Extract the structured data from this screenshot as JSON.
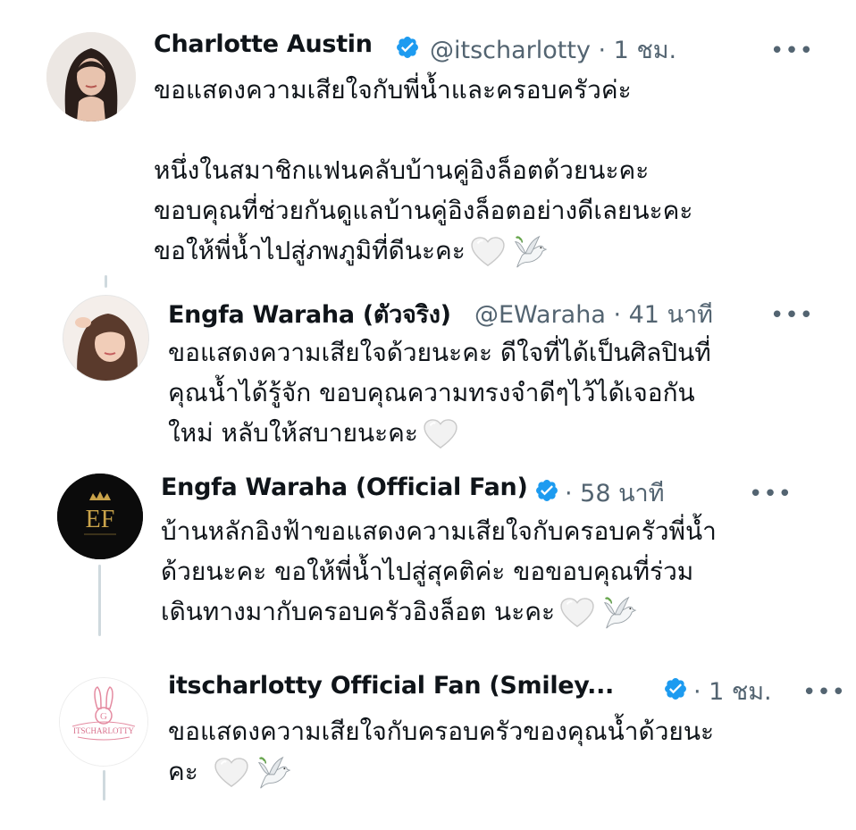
{
  "tweets": [
    {
      "name": "Charlotte Austin",
      "verified": true,
      "handle_time": "@itscharlotty · 1 ชม.",
      "text": "ขอแสดงความเสียใจกับพี่น้ำและครอบครัวค่ะ\n\nหนึ่งในสมาชิกแฟนคลับบ้านคู่อิงล็อตด้วยนะคะ\nขอบคุณที่ช่วยกันดูแลบ้านคู่อิงล็อตอย่างดีเลยนะคะ\nขอให้พี่น้ำไปสู่ภพภูมิที่ดีนะคะ",
      "emojis": [
        "white-heart-icon",
        "dove-icon"
      ],
      "more": "•••"
    },
    {
      "name": "Engfa Waraha (ตัวจริง)",
      "verified": false,
      "handle_time": "@EWaraha · 41 นาที",
      "text": "ขอแสดงความเสียใจด้วยนะคะ ดีใจที่ได้เป็นศิลปินที่\nคุณน้ำได้รู้จัก ขอบคุณความทรงจำดีๆไว้ได้เจอกัน\nใหม่ หลับให้สบายนะคะ",
      "emojis": [
        "white-heart-icon"
      ],
      "more": "•••"
    },
    {
      "name": "Engfa Waraha (Official Fan)",
      "verified": true,
      "handle_time": "· 58 นาที",
      "text": "บ้านหลักอิงฟ้าขอแสดงความเสียใจกับครอบครัวพี่น้ำ\nด้วยนะคะ ขอให้พี่น้ำไปสู่สุคติค่ะ ขอขอบคุณที่ร่วม\nเดินทางมากับครอบครัวอิงล็อต นะคะ",
      "emojis": [
        "white-heart-icon",
        "dove-icon"
      ],
      "more": "•••",
      "avatar_logo": "EF"
    },
    {
      "name": "itscharlotty Official Fan (Smiley...",
      "verified": true,
      "handle_time": "· 1 ชม.",
      "text": "ขอแสดงความเสียใจกับครอบครัวของคุณน้ำด้วยนะ\nคะ",
      "emojis": [
        "white-heart-icon",
        "dove-icon"
      ],
      "more": "•••",
      "avatar_logo": "ITSCHARLOTTY"
    }
  ],
  "colors": {
    "verified": "#1d9bf0",
    "secondary_text": "#536471",
    "thread_line": "#cfd9de"
  }
}
